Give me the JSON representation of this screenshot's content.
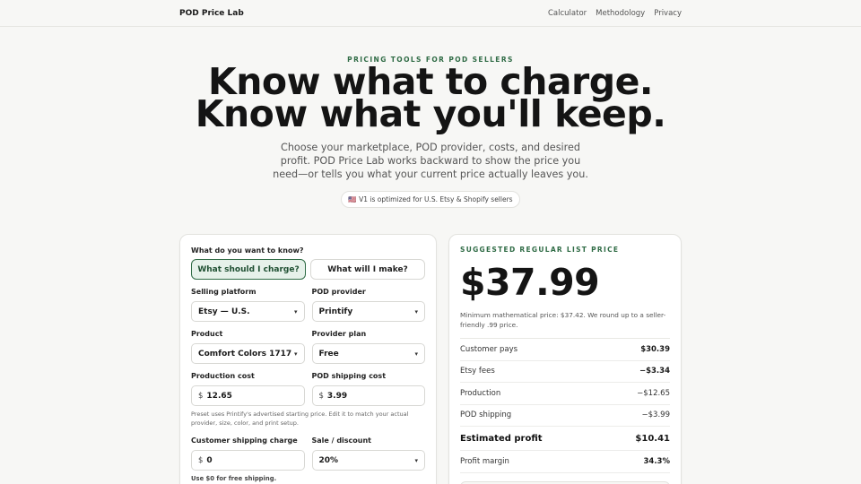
{
  "nav": {
    "brand": "POD Price Lab",
    "links": [
      "Calculator",
      "Methodology",
      "Privacy"
    ]
  },
  "hero": {
    "eyebrow": "PRICING TOOLS FOR POD SELLERS",
    "headline_1": "Know what to charge.",
    "headline_2": "Know what you'll keep.",
    "subtext": "Choose your marketplace, POD provider, costs, and desired profit. POD Price Lab works backward to show the price you need—or tells you what your current price actually leaves you.",
    "pill_flag": "🇺🇸",
    "pill_text": "V1 is optimized for U.S. Etsy & Shopify sellers"
  },
  "form": {
    "question": "What do you want to know?",
    "mode_options": [
      "What should I charge?",
      "What will I make?"
    ],
    "selected_mode": "What should I charge?",
    "selling_platform": {
      "label": "Selling platform",
      "value": "Etsy — U.S."
    },
    "pod_provider": {
      "label": "POD provider",
      "value": "Printify"
    },
    "product": {
      "label": "Product",
      "value": "Comfort Colors 1717"
    },
    "provider_plan": {
      "label": "Provider plan",
      "value": "Free"
    },
    "production_cost": {
      "label": "Production cost",
      "currency": "$",
      "value": "12.65"
    },
    "pod_shipping_cost": {
      "label": "POD shipping cost",
      "currency": "$",
      "value": "3.99"
    },
    "preset_hint": "Preset uses Printify's advertised starting price. Edit it to match your actual provider, size, color, and print setup.",
    "customer_shipping_charge": {
      "label": "Customer shipping charge",
      "currency": "$",
      "value": "0"
    },
    "sale_discount": {
      "label": "Sale / discount",
      "value": "20%"
    },
    "shipping_hint": "Use $0 for free shipping."
  },
  "result": {
    "eyebrow": "SUGGESTED REGULAR LIST PRICE",
    "price": "$37.99",
    "note": "Minimum mathematical price: $37.42. We round up to a seller-friendly .99 price.",
    "rows": [
      {
        "label": "Customer pays",
        "value": "$30.39"
      },
      {
        "label": "Etsy fees",
        "value": "−$3.34"
      },
      {
        "label": "Production",
        "value": "−$12.65"
      },
      {
        "label": "POD shipping",
        "value": "−$3.99"
      },
      {
        "label": "Estimated profit",
        "value": "$10.41"
      },
      {
        "label": "Profit margin",
        "value": "34.3%"
      }
    ]
  },
  "colors": {
    "accent": "#2f6b45",
    "background": "#f7f7f5"
  }
}
